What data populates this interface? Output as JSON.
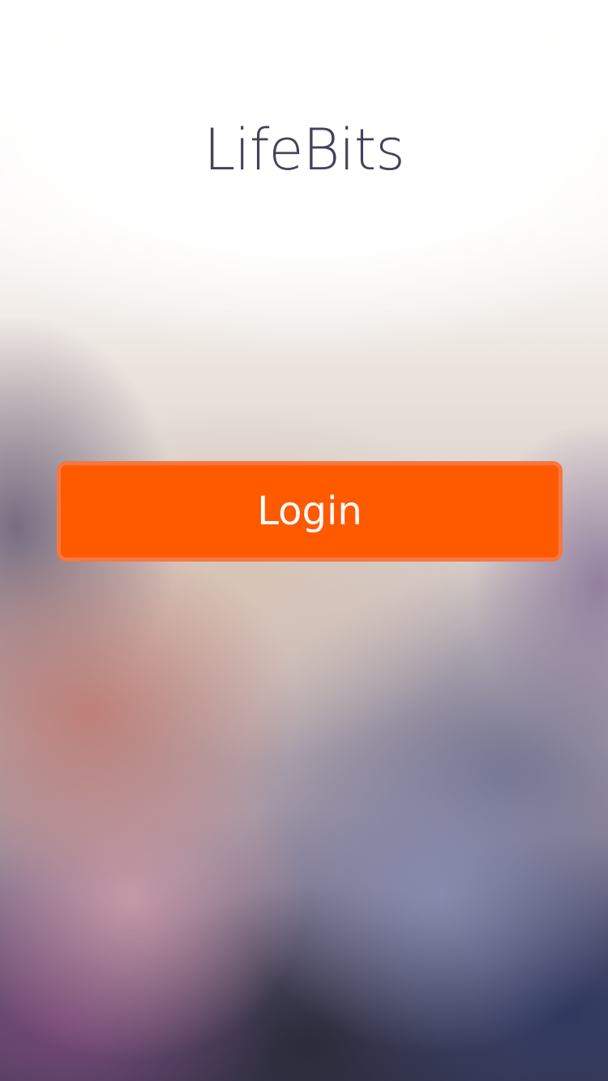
{
  "app": {
    "title": "LifeBits"
  },
  "actions": {
    "login_label": "Login"
  },
  "colors": {
    "accent": "#ff5a00",
    "title_text": "#45425a"
  }
}
